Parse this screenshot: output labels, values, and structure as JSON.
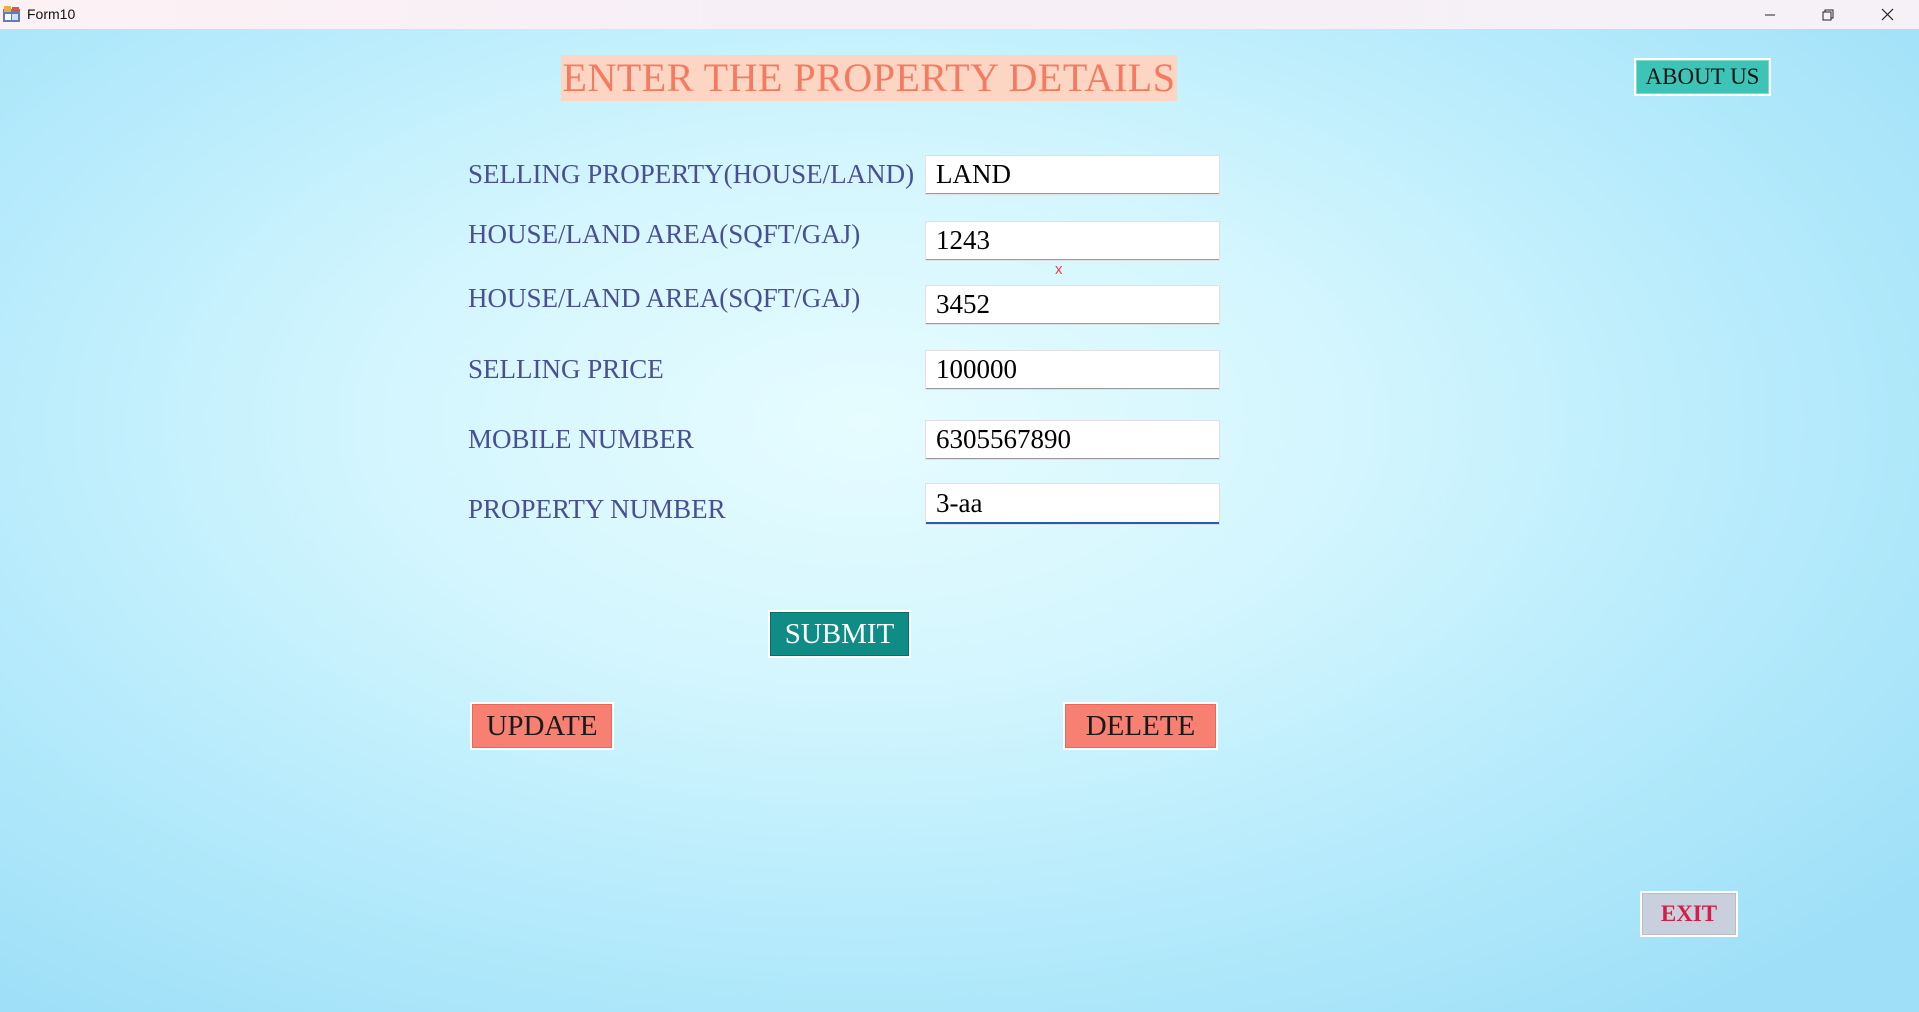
{
  "window": {
    "title": "Form10"
  },
  "form": {
    "heading": "ENTER THE PROPERTY DETAILS",
    "fields": [
      {
        "label": "SELLING PROPERTY(HOUSE/LAND)",
        "value": "LAND"
      },
      {
        "label": "HOUSE/LAND AREA(SQFT/GAJ)",
        "value": "1243"
      },
      {
        "label": "HOUSE/LAND AREA(SQFT/GAJ)",
        "value": "3452"
      },
      {
        "label": "SELLING PRICE",
        "value": "100000"
      },
      {
        "label": "MOBILE NUMBER",
        "value": "6305567890"
      },
      {
        "label": "PROPERTY NUMBER",
        "value": "3-aa"
      }
    ],
    "error_mark": "x"
  },
  "buttons": {
    "about": "ABOUT US",
    "submit": "SUBMIT",
    "update": "UPDATE",
    "delete": "DELETE",
    "exit": "EXIT"
  },
  "icons": {
    "app": "form-app-icon",
    "minimize": "minimize-icon",
    "maximize": "restore-icon",
    "close": "close-icon"
  },
  "colors": {
    "heading_bg": "#fcd6c2",
    "heading_text": "#f47a62",
    "label_text": "#4a4f92",
    "submit_bg": "#0f8c86",
    "about_bg": "#3ec4b7",
    "update_delete_bg": "#f88072",
    "exit_bg": "#c9cfdc",
    "exit_text": "#d21f4a"
  }
}
